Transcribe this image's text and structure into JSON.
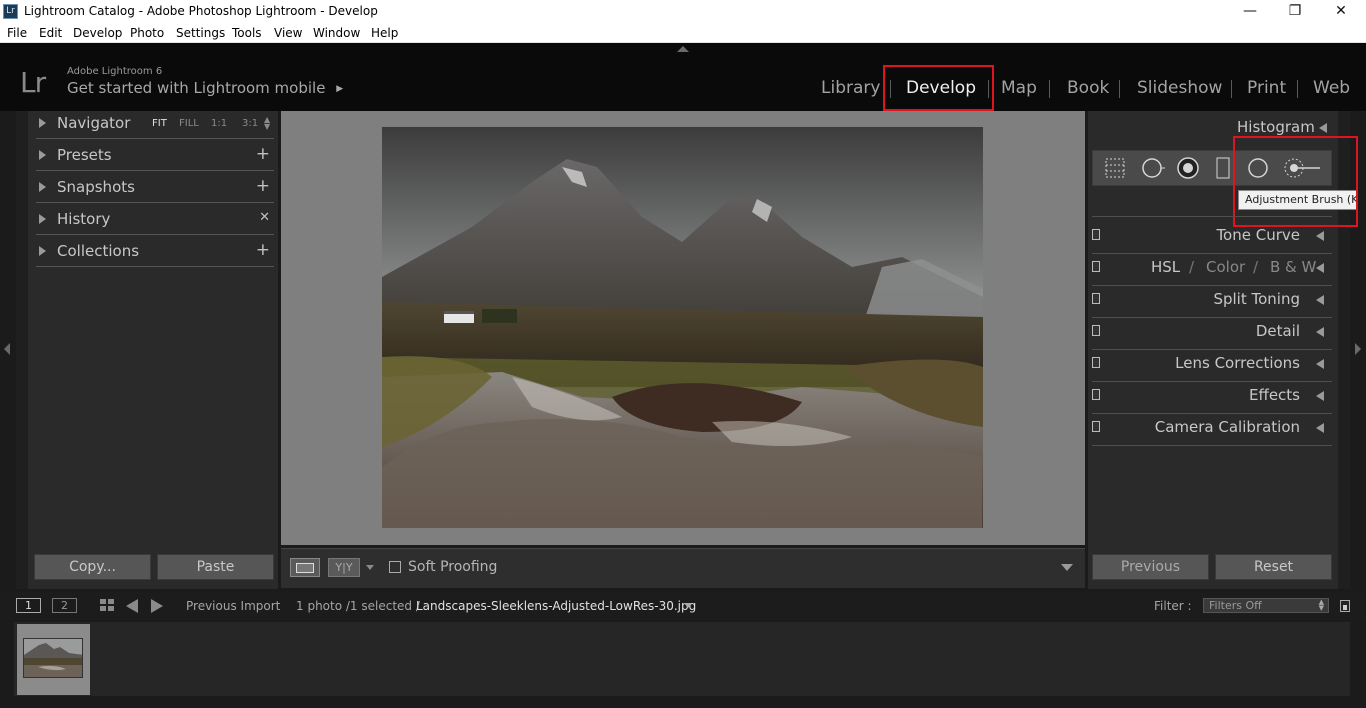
{
  "window": {
    "title": "Lightroom Catalog - Adobe Photoshop Lightroom - Develop",
    "app_icon": "Lr",
    "controls": {
      "minimize": "—",
      "restore": "❐",
      "close": "✕"
    }
  },
  "menu": [
    "File",
    "Edit",
    "Develop",
    "Photo",
    "Settings",
    "Tools",
    "View",
    "Window",
    "Help"
  ],
  "identity": {
    "logo": "Lr",
    "product": "Adobe Lightroom 6",
    "mobile_prompt": "Get started with Lightroom mobile",
    "mobile_arrow": "▶"
  },
  "modules": {
    "items": [
      "Library",
      "Develop",
      "Map",
      "Book",
      "Slideshow",
      "Print",
      "Web"
    ],
    "active": "Develop"
  },
  "left_panel": {
    "navigator": {
      "label": "Navigator",
      "sizes": [
        "FIT",
        "FILL",
        "1:1",
        "3:1"
      ]
    },
    "sections": [
      {
        "label": "Presets",
        "action": "+"
      },
      {
        "label": "Snapshots",
        "action": "+"
      },
      {
        "label": "History",
        "action": "✕"
      },
      {
        "label": "Collections",
        "action": "+"
      }
    ],
    "copy_button": "Copy...",
    "paste_button": "Paste"
  },
  "toolbar": {
    "soft_proofing": "Soft Proofing",
    "compare_label": "Y|Y"
  },
  "right_panel": {
    "histogram": "Histogram",
    "tools": [
      "crop-overlay",
      "spot-removal",
      "red-eye",
      "graduated-filter",
      "radial-filter",
      "adjustment-brush"
    ],
    "tooltip": "Adjustment Brush (K)",
    "sections": [
      {
        "label": "Tone Curve"
      },
      {
        "label": "HSL",
        "extra": [
          "/",
          "Color",
          "/",
          "B & W"
        ]
      },
      {
        "label": "Split Toning"
      },
      {
        "label": "Detail"
      },
      {
        "label": "Lens Corrections"
      },
      {
        "label": "Effects"
      },
      {
        "label": "Camera Calibration"
      }
    ],
    "previous_button": "Previous",
    "reset_button": "Reset"
  },
  "filmstrip": {
    "page1": "1",
    "page2": "2",
    "source": "Previous Import",
    "count": "1 photo /1 selected /",
    "filename": "Landscapes-Sleeklens-Adjusted-LowRes-30.jpg",
    "filter_label": "Filter :",
    "filter_value": "Filters Off"
  },
  "colors": {
    "accent_highlight": "#e0141e",
    "panel_bg": "#2a2a2a",
    "center_bg": "#7f7f7f"
  }
}
